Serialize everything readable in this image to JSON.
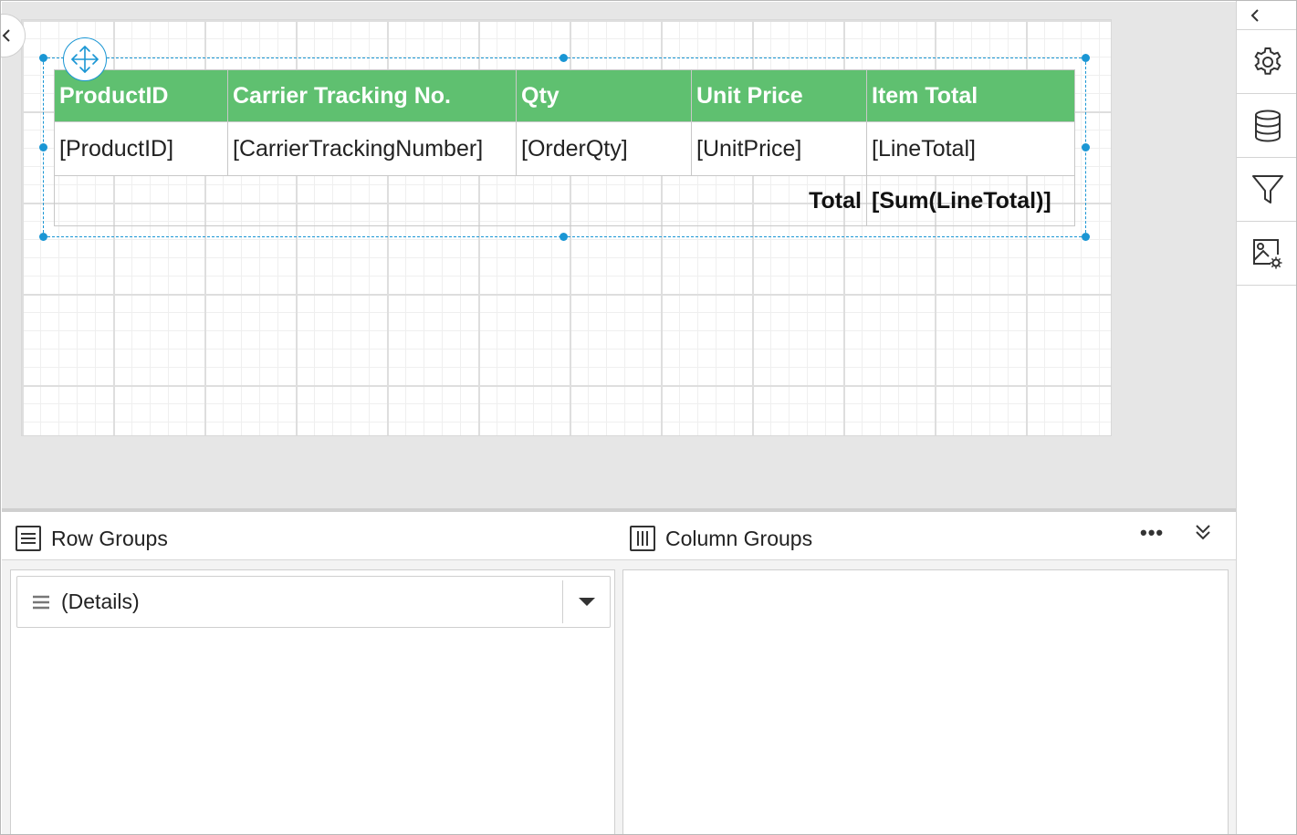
{
  "table": {
    "headers": [
      "ProductID",
      "Carrier Tracking No.",
      "Qty",
      "Unit Price",
      "Item Total"
    ],
    "detail_row": [
      "[ProductID]",
      "[CarrierTrackingNumber]",
      "[OrderQty]",
      "[UnitPrice]",
      "[LineTotal]"
    ],
    "total_label": "Total",
    "total_value": "[Sum(LineTotal)]",
    "header_color": "#5fc070"
  },
  "selection_color": "#1a96d4",
  "groups": {
    "row_groups_title": "Row Groups",
    "column_groups_title": "Column Groups",
    "more_label": "•••",
    "row_items": [
      {
        "label": "(Details)"
      }
    ]
  },
  "right_rail": {
    "buttons": [
      "gear-icon",
      "database-icon",
      "filter-icon",
      "image-settings-icon"
    ]
  }
}
